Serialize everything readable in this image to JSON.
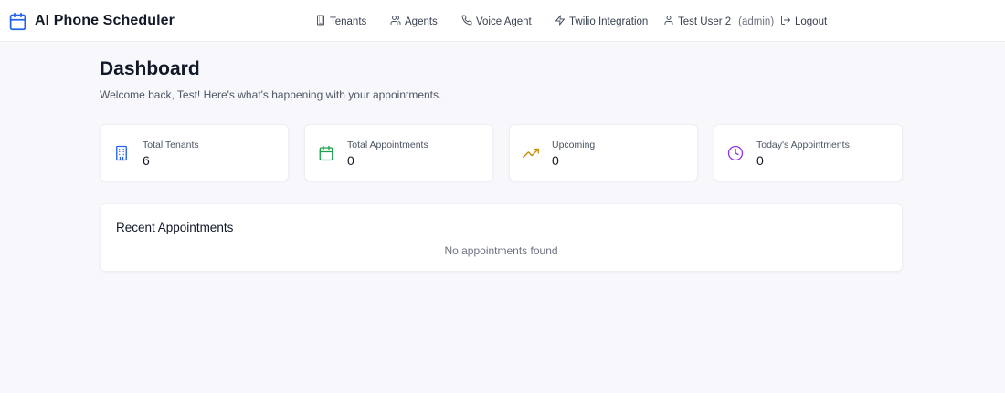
{
  "app": {
    "title": "AI Phone Scheduler",
    "icon": "calendar-icon",
    "accent": "#2563eb"
  },
  "nav": {
    "tenants": "Tenants",
    "agents": "Agents",
    "voice_agent": "Voice Agent",
    "twilio": "Twilio Integration",
    "user_name": "Test User 2",
    "user_role": "(admin)",
    "logout": "Logout"
  },
  "page": {
    "title": "Dashboard",
    "subtitle": "Welcome back, Test! Here's what's happening with your appointments."
  },
  "stats": [
    {
      "label": "Total Tenants",
      "value": "6",
      "icon": "building-icon",
      "color": "#2563eb"
    },
    {
      "label": "Total Appointments",
      "value": "0",
      "icon": "calendar-icon",
      "color": "#16a34a"
    },
    {
      "label": "Upcoming",
      "value": "0",
      "icon": "trending-up-icon",
      "color": "#ca8a04"
    },
    {
      "label": "Today's Appointments",
      "value": "0",
      "icon": "clock-icon",
      "color": "#9333ea"
    }
  ],
  "recent": {
    "title": "Recent Appointments",
    "empty_message": "No appointments found"
  }
}
